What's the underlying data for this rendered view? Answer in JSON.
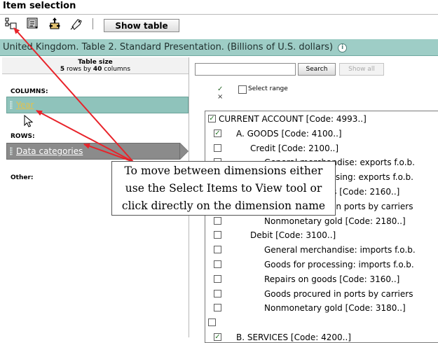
{
  "header": {
    "title": "Item selection"
  },
  "toolbar": {
    "icons": [
      "pivot-layout-icon",
      "select-items-icon",
      "move-dimension-icon",
      "tag-icon"
    ],
    "show_table": "Show table"
  },
  "presentation_bar": {
    "text": "United Kingdom. Table 2. Standard Presentation. (Billions of U.S. dollars)",
    "info_icon": "i"
  },
  "left_panel": {
    "table_size_title": "Table size",
    "table_size_rows": "5",
    "table_size_rows_text": " rows by ",
    "table_size_cols": "40",
    "table_size_cols_text": " columns",
    "columns_label": "COLUMNS:",
    "column_dimension": "Year",
    "rows_label": "ROWS:",
    "row_dimension": "Data categories",
    "other_label": "Other:"
  },
  "right_panel": {
    "search_placeholder": "",
    "search_button": "Search",
    "show_all_button": "Show all",
    "check_all_glyph": "✓",
    "uncheck_all_glyph": "×",
    "select_range": "Select range"
  },
  "tree": {
    "items": [
      {
        "label": "CURRENT ACCOUNT  [Code: 4993..]",
        "checked": true,
        "indent": 0
      },
      {
        "label": "A. GOODS  [Code: 4100..]",
        "checked": true,
        "indent": 1
      },
      {
        "label": "Credit  [Code: 2100..]",
        "checked": false,
        "indent": 2
      },
      {
        "label": "General merchandise: exports f.o.b.",
        "checked": false,
        "indent": 3
      },
      {
        "label": "Goods for processing: exports f.o.b.",
        "checked": false,
        "indent": 3
      },
      {
        "label": "Repairs on goods  [Code: 2160..]",
        "checked": false,
        "indent": 3
      },
      {
        "label": "Goods procured in ports by carriers",
        "checked": false,
        "indent": 3
      },
      {
        "label": "Nonmonetary gold  [Code: 2180..]",
        "checked": false,
        "indent": 3
      },
      {
        "label": "Debit  [Code: 3100..]",
        "checked": false,
        "indent": 2
      },
      {
        "label": "General merchandise: imports f.o.b.",
        "checked": false,
        "indent": 3
      },
      {
        "label": "Goods for processing: imports f.o.b.",
        "checked": false,
        "indent": 3
      },
      {
        "label": "Repairs on goods  [Code: 3160..]",
        "checked": false,
        "indent": 3
      },
      {
        "label": "Goods procured in ports by carriers",
        "checked": false,
        "indent": 3
      },
      {
        "label": "Nonmonetary gold  [Code: 3180..]",
        "checked": false,
        "indent": 3
      },
      {
        "label": "",
        "checked": false,
        "indent": 0
      },
      {
        "label": "B. SERVICES  [Code: 4200..]",
        "checked": true,
        "indent": 1
      }
    ]
  },
  "callout": {
    "line1": "To move between dimensions either",
    "line2": "use the Select Items to View tool or",
    "line3": "click directly on the dimension name"
  },
  "colors": {
    "presentation_bar": "#9ecdc6",
    "active_dimension": "#8fc3bb",
    "inactive_dimension": "#8b8b8b",
    "annotation_arrow": "#e8232a",
    "year_text": "#e6c24a"
  }
}
